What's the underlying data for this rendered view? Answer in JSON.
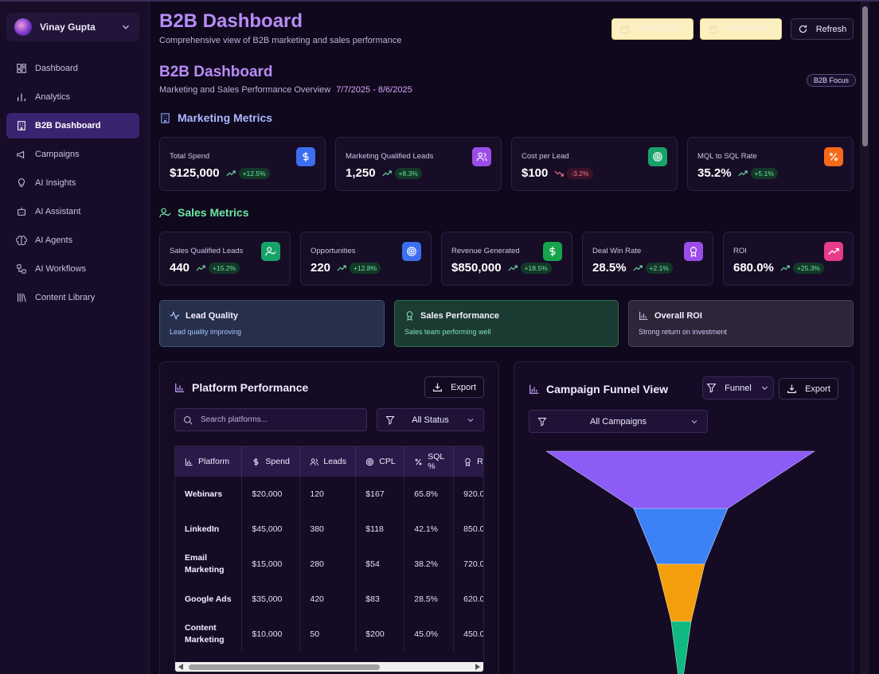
{
  "user": {
    "name": "Vinay Gupta"
  },
  "sidebar": {
    "items": [
      {
        "label": "Dashboard",
        "icon": "grid-icon"
      },
      {
        "label": "Analytics",
        "icon": "bar-chart-icon"
      },
      {
        "label": "B2B Dashboard",
        "icon": "building-icon",
        "active": true
      },
      {
        "label": "Campaigns",
        "icon": "megaphone-icon"
      },
      {
        "label": "AI Insights",
        "icon": "lightbulb-icon"
      },
      {
        "label": "AI Assistant",
        "icon": "bot-icon"
      },
      {
        "label": "AI Agents",
        "icon": "brain-icon"
      },
      {
        "label": "AI Workflows",
        "icon": "workflow-icon"
      },
      {
        "label": "Content Library",
        "icon": "library-icon"
      }
    ]
  },
  "header": {
    "title": "B2B Dashboard",
    "subtitle": "Comprehensive view of B2B marketing and sales performance",
    "start_date": "07/07/2025",
    "end_date": "08/06/2025",
    "refresh_label": "Refresh"
  },
  "overview": {
    "title": "B2B Dashboard",
    "subtitle": "Marketing and Sales Performance Overview",
    "range": "7/7/2025 - 8/6/2025",
    "badge": "B2B Focus"
  },
  "marketing": {
    "title": "Marketing Metrics",
    "cards": [
      {
        "label": "Total Spend",
        "value": "$125,000",
        "change": "+12.5%",
        "color": "#3b6ff0"
      },
      {
        "label": "Marketing Qualified Leads",
        "value": "1,250",
        "change": "+8.3%",
        "color": "#9b4de8"
      },
      {
        "label": "Cost per Lead",
        "value": "$100",
        "change": "-3.2%",
        "color": "#16a36a"
      },
      {
        "label": "MQL to SQL Rate",
        "value": "35.2%",
        "change": "+5.1%",
        "color": "#f56a1a"
      }
    ]
  },
  "sales": {
    "title": "Sales Metrics",
    "cards": [
      {
        "label": "Sales Qualified Leads",
        "value": "440",
        "change": "+15.2%",
        "color": "#16a36a"
      },
      {
        "label": "Opportunities",
        "value": "220",
        "change": "+12.8%",
        "color": "#3b6ff0"
      },
      {
        "label": "Revenue Generated",
        "value": "$850,000",
        "change": "+18.5%",
        "color": "#16a34a"
      },
      {
        "label": "Deal Win Rate",
        "value": "28.5%",
        "change": "+2.1%",
        "color": "#9b4de8"
      },
      {
        "label": "ROI",
        "value": "680.0%",
        "change": "+25.3%",
        "color": "#e83c8a"
      }
    ]
  },
  "status": [
    {
      "title": "Lead Quality",
      "text": "Lead quality improving"
    },
    {
      "title": "Sales Performance",
      "text": "Sales team performing well"
    },
    {
      "title": "Overall ROI",
      "text": "Strong return on investment"
    }
  ],
  "platform": {
    "title": "Platform Performance",
    "export_label": "Export",
    "search_placeholder": "Search platforms...",
    "status_filter": "All Status",
    "columns": [
      "Platform",
      "Spend",
      "Leads",
      "CPL",
      "SQL %",
      "R"
    ],
    "rows": [
      [
        "Webinars",
        "$20,000",
        "120",
        "$167",
        "65.8%",
        "920.0"
      ],
      [
        "LinkedIn",
        "$45,000",
        "380",
        "$118",
        "42.1%",
        "850.0"
      ],
      [
        "Email Marketing",
        "$15,000",
        "280",
        "$54",
        "38.2%",
        "720.0"
      ],
      [
        "Google Ads",
        "$35,000",
        "420",
        "$83",
        "28.5%",
        "620.0"
      ],
      [
        "Content Marketing",
        "$10,000",
        "50",
        "$200",
        "45.0%",
        "450.0"
      ]
    ]
  },
  "funnel": {
    "title": "Campaign Funnel View",
    "view_label": "Funnel",
    "export_label": "Export",
    "campaign_filter": "All Campaigns",
    "colors": [
      "#8b5cf6",
      "#3b82f6",
      "#f59e0b",
      "#10b981"
    ]
  }
}
